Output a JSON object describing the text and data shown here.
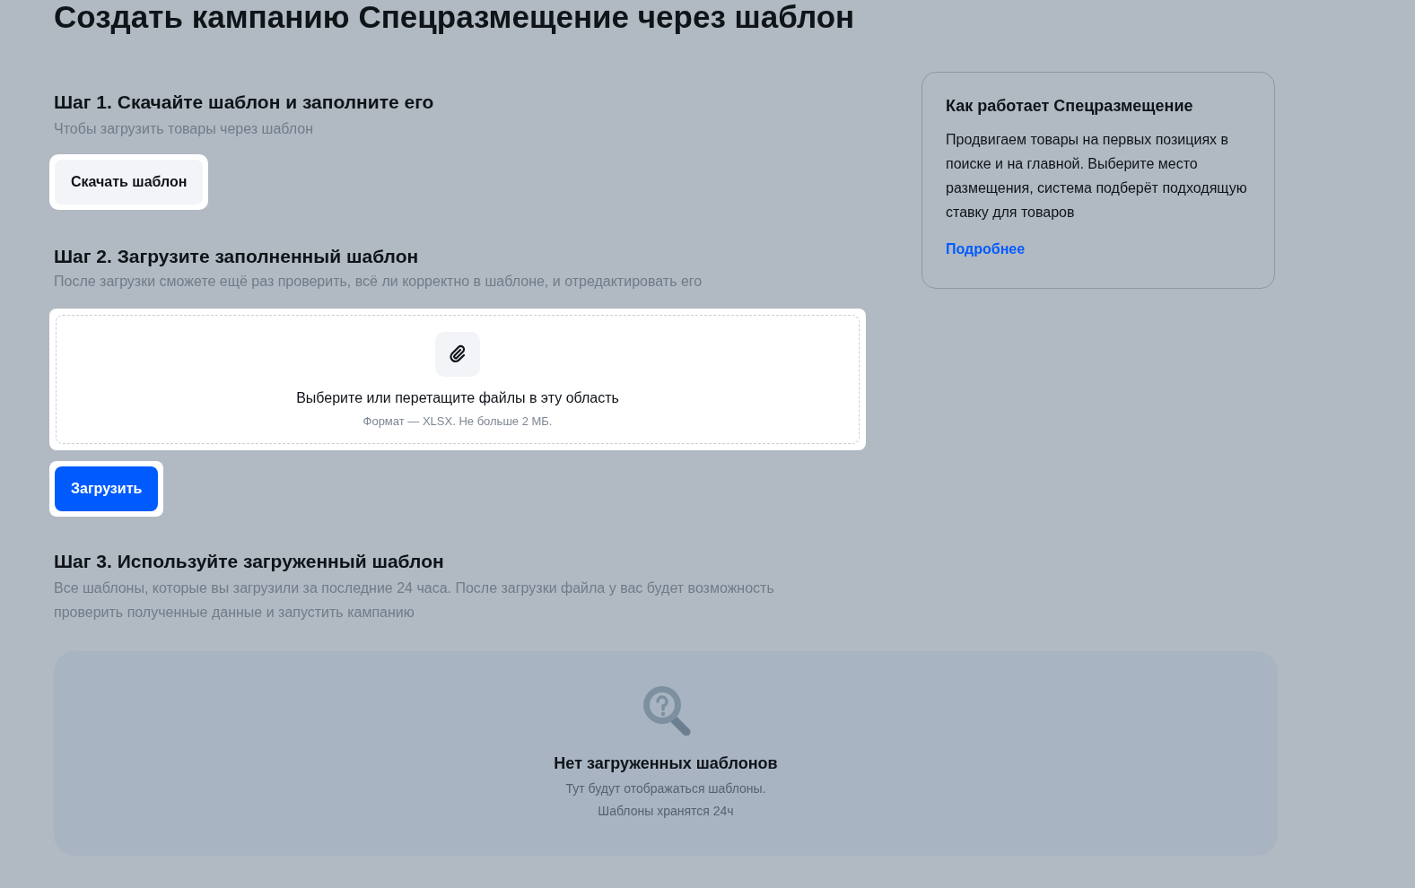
{
  "title": "Создать кампанию Спецразмещение через шаблон",
  "step1": {
    "heading": "Шаг 1. Скачайте шаблон и заполните его",
    "subtitle": "Чтобы загрузить товары через шаблон",
    "button": "Скачать шаблон"
  },
  "step2": {
    "heading": "Шаг 2. Загрузите заполненный шаблон",
    "subtitle": "После загрузки сможете ещё раз проверить, всё ли корректно в шаблоне, и отредактировать его",
    "dropzone": {
      "label": "Выберите или перетащите файлы в эту область",
      "hint": "Формат — XLSX. Не больше 2 МБ."
    },
    "button": "Загрузить"
  },
  "step3": {
    "heading": "Шаг 3. Используйте загруженный шаблон",
    "subtitle": "Все шаблоны, которые вы загрузили за последние 24 часа. После загрузки файла у вас будет возможность проверить полученные данные и запустить кампанию",
    "empty": {
      "title": "Нет загруженных шаблонов",
      "lines": [
        "Тут будут отображаться шаблоны.",
        "Шаблоны хранятся 24ч"
      ]
    }
  },
  "info_card": {
    "title": "Как работает Спецразмещение",
    "text": "Продвигаем товары на первых позициях в поиске и на главной. Выберите место размещения, система подберёт подходящую ставку для товаров",
    "link": "Подробнее"
  }
}
